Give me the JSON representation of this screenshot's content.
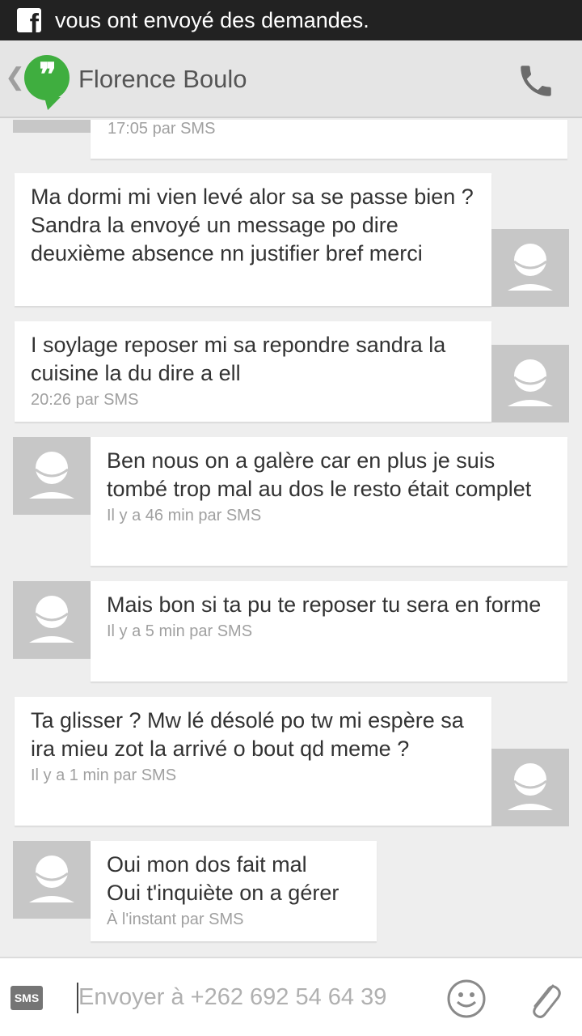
{
  "status_bar": {
    "notification_icon": "facebook-icon",
    "text": "vous ont envoyé des demandes."
  },
  "header": {
    "back_icon": "chevron-left-icon",
    "app_icon": "hangouts-icon",
    "contact_name": "Florence Boulo",
    "call_icon": "phone-icon"
  },
  "messages": [
    {
      "direction": "incoming",
      "text": "",
      "time": "17:05 par SMS"
    },
    {
      "direction": "outgoing",
      "text": "Ma dormi mi vien levé alor sa se passe bien ? Sandra la envoyé un message po dire deuxième absence nn justifier bref merci",
      "time": ""
    },
    {
      "direction": "outgoing",
      "text": "I soylage reposer mi sa repondre sandra la cuisine la du dire a ell",
      "time": "20:26 par SMS"
    },
    {
      "direction": "incoming",
      "text": "Ben nous on a galère car en plus je suis tombé trop mal au dos le resto était complet",
      "time": "Il y a 46 min par SMS"
    },
    {
      "direction": "incoming",
      "text": "Mais bon si ta pu te reposer tu sera en forme",
      "time": "Il y a 5 min par SMS"
    },
    {
      "direction": "outgoing",
      "text": "Ta glisser ?  Mw lé désolé po tw mi espère sa ira mieu zot la arrivé o bout qd meme ?",
      "time": "Il y a 1 min par SMS"
    },
    {
      "direction": "incoming",
      "text": "Oui mon dos fait mal\nOui t'inquiète on a gérer",
      "time": "À l'instant par SMS"
    }
  ],
  "composer": {
    "mode_label": "SMS",
    "placeholder": "Envoyer à +262 692 54 64 39",
    "emoji_icon": "smiley-icon",
    "attach_icon": "paperclip-icon"
  },
  "colors": {
    "status_bar": "#222222",
    "header": "#e5e5e5",
    "background": "#eeeeee",
    "bubble": "#ffffff",
    "avatar": "#c7c7c7",
    "hangouts_green": "#3fae3f"
  }
}
